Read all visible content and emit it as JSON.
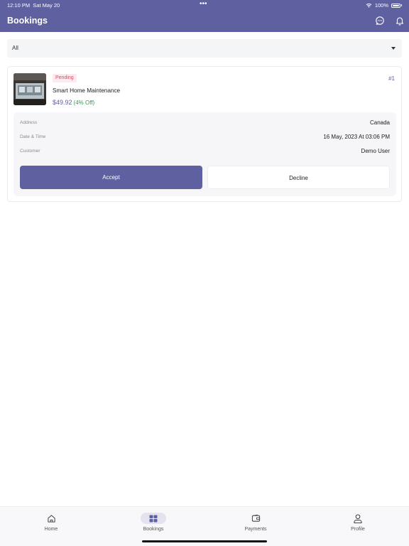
{
  "status_bar": {
    "time": "12:10 PM",
    "date": "Sat May 20",
    "battery": "100%"
  },
  "header": {
    "title": "Bookings",
    "chat_icon": "chat-bubble-icon",
    "notification_icon": "bell-icon"
  },
  "filter": {
    "selected": "All"
  },
  "booking": {
    "status": "Pending",
    "id": "#1",
    "service": "Smart Home Maintenance",
    "price": "$49.92",
    "discount": "(4% Off)",
    "details": [
      {
        "label": "Address",
        "value": "Canada"
      },
      {
        "label": "Date & Time",
        "value": "16 May, 2023 At 03:06 PM"
      },
      {
        "label": "Customer",
        "value": "Demo User"
      }
    ],
    "accept_label": "Accept",
    "decline_label": "Decline"
  },
  "tabs": [
    {
      "label": "Home",
      "icon": "home-icon",
      "active": false
    },
    {
      "label": "Bookings",
      "icon": "bookings-icon",
      "active": true
    },
    {
      "label": "Payments",
      "icon": "wallet-icon",
      "active": false
    },
    {
      "label": "Profile",
      "icon": "profile-icon",
      "active": false
    }
  ],
  "colors": {
    "primary": "#5F60A0",
    "pending": "#E0495F",
    "discount": "#2E9D4F"
  }
}
